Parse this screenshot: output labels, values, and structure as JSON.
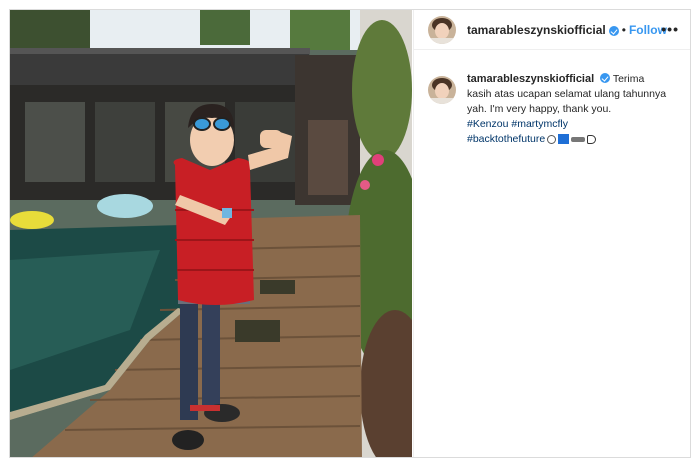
{
  "post": {
    "username": "tamarableszynskiofficial",
    "dot": "•",
    "follow_label": "Follow",
    "more_label": "•••"
  },
  "caption": {
    "username": "tamarableszynskiofficial",
    "text": "Terima kasih atas ucapan selamat ulang tahunnya yah. I'm very happy, thank you.",
    "hashtags": [
      "#Kenzou",
      "#martymcfly",
      "#backtothefuture"
    ]
  },
  "icons": {
    "verified": "verified-badge-icon",
    "more": "more-options-icon",
    "emojis": [
      "clock-emoji",
      "blue-square-emoji",
      "car-emoji",
      "pointing-hand-emoji"
    ]
  },
  "colors": {
    "link_blue": "#3897f0",
    "hashtag": "#003569",
    "text": "#262626",
    "border": "#dbdbdb",
    "verified": "#3897f0"
  }
}
